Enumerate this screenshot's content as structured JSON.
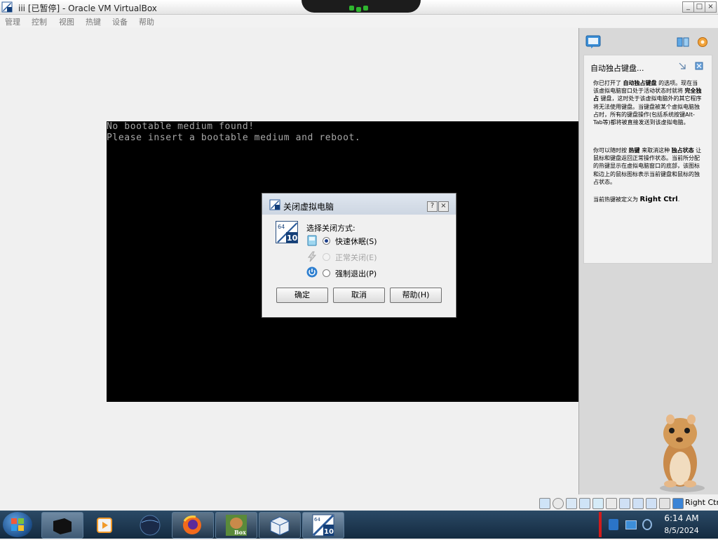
{
  "window": {
    "title": "iii [已暂停] - Oracle VM VirtualBox"
  },
  "menu": [
    "管理",
    "控制",
    "视图",
    "热键",
    "设备",
    "帮助"
  ],
  "vm_screen": {
    "line1": "No bootable medium found!",
    "line2": "Please insert a bootable medium and reboot."
  },
  "dialog": {
    "title": "关闭虚拟电脑",
    "prompt": "选择关闭方式:",
    "options": [
      {
        "label": "快速休眠(S)",
        "selected": true,
        "enabled": true,
        "icon": "save-state-icon"
      },
      {
        "label": "正常关闭(E)",
        "selected": false,
        "enabled": false,
        "icon": "lightning-icon"
      },
      {
        "label": "强制退出(P)",
        "selected": false,
        "enabled": true,
        "icon": "power-icon"
      }
    ],
    "buttons": {
      "ok": "确定",
      "cancel": "取消",
      "help": "帮助(H)"
    },
    "icon_badge_top": "64",
    "icon_badge_bottom": "10"
  },
  "help_panel": {
    "title": "自动独占键盘...",
    "p1_parts": [
      "你已打开了 ",
      "自动独占键盘",
      " 的选项。现在当该虚拟电脑窗口处于活动状态时就将 ",
      "完全独占",
      " 键盘，这时处于该虚拟电脑外的其它程序将无法使用键盘。当键盘被某个虚拟电脑独占时，所有的键盘操作(包括系统按键Alt-Tab等)都将被直接发送到该虚拟电脑。"
    ],
    "p2_parts": [
      "你可以随时按 ",
      "热键",
      " 来取消这种 ",
      "独占状态",
      " 让鼠标和键盘返回正常操作状态。当前所分配的热键显示在虚拟电脑窗口的底部，该图标和边上的鼠标图标表示当前键盘和鼠标的独占状态。"
    ],
    "p3_parts": [
      "当前热键被定义为 ",
      "Right Ctrl",
      "."
    ]
  },
  "status_bar": {
    "host_key": "Right Ctrl"
  },
  "taskbar": {
    "time": "6:14 AM",
    "date": "8/5/2024",
    "vbox_badge_top": "64",
    "vbox_badge_bottom": "10",
    "box_label": "Box"
  },
  "colors": {
    "vm_background": "#000000",
    "boot_text": "#a8a8a8",
    "taskbar": "#1d3650",
    "accent_blue": "#1e3f8a"
  }
}
